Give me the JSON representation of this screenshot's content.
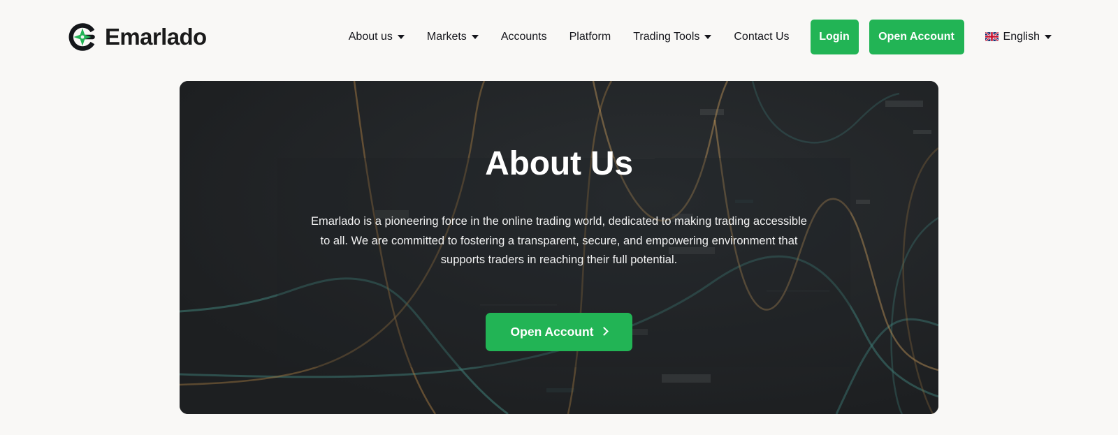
{
  "brand": {
    "name": "Emarlado",
    "logo_icon": "emarlado-ring-star-logo",
    "ring_color": "#14161a",
    "star_color": "#22b455"
  },
  "nav": {
    "items": [
      {
        "label": "About us",
        "has_dropdown": true
      },
      {
        "label": "Markets",
        "has_dropdown": true
      },
      {
        "label": "Accounts",
        "has_dropdown": false
      },
      {
        "label": "Platform",
        "has_dropdown": false
      },
      {
        "label": "Trading Tools",
        "has_dropdown": true
      },
      {
        "label": "Contact Us",
        "has_dropdown": false
      }
    ],
    "login_label": "Login",
    "open_account_label": "Open Account",
    "language": {
      "label": "English",
      "flag_icon": "uk-flag-icon",
      "has_dropdown": true
    }
  },
  "hero": {
    "title": "About Us",
    "paragraph": "Emarlado is a pioneering force in the online trading world, dedicated to making trading accessible to all. We are committed to fostering a transparent, secure, and empowering environment that supports traders in reaching their full potential.",
    "cta_label": "Open Account",
    "cta_icon": "chevron-right-icon",
    "background": "dark-trading-chart-texture"
  },
  "colors": {
    "page_background": "#f9f8f6",
    "accent_green": "#22b455",
    "hero_background": "#1f2123",
    "text_dark": "#15161c",
    "text_light": "#ffffff",
    "chart_teal": "#3f7f79",
    "chart_orange": "#9a7340"
  }
}
